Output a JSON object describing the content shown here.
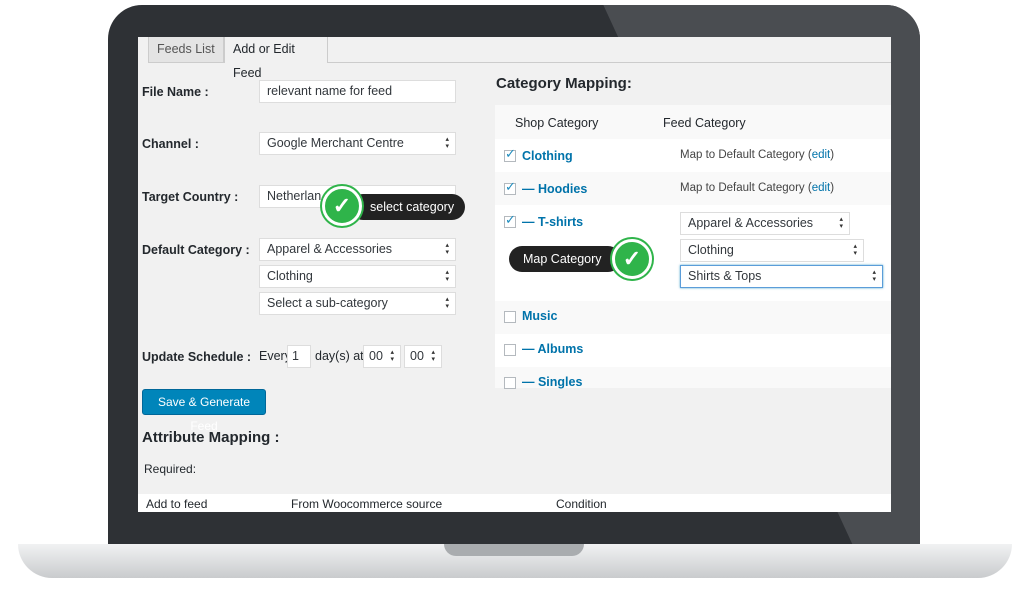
{
  "tabs": [
    "Feeds List",
    "Add or Edit Feed"
  ],
  "form": {
    "file_name_label": "File Name :",
    "file_name_value": "relevant name for feed",
    "channel_label": "Channel :",
    "channel_value": "Google Merchant Centre",
    "country_label": "Target Country :",
    "country_value": "Netherlan",
    "default_category_label": "Default Category :",
    "default_category_values": [
      "Apparel & Accessories",
      "Clothing",
      "Select a sub-category"
    ],
    "schedule_label": "Update Schedule :",
    "schedule_every": "Every",
    "schedule_count": "1",
    "schedule_days_at": "day(s) at",
    "schedule_hour": "00",
    "schedule_minute": "00",
    "save_button": "Save & Generate Feed"
  },
  "attribute_mapping": {
    "title": "Attribute Mapping :",
    "required": "Required:",
    "columns": [
      "Add to feed",
      "From Woocommerce source",
      "Condition"
    ]
  },
  "category_mapping": {
    "title": "Category Mapping:",
    "headers": [
      "Shop Category",
      "Feed Category"
    ],
    "rows": [
      {
        "name": "Clothing",
        "checked": true,
        "map_text": "Map to Default Category",
        "edit": "edit"
      },
      {
        "name": "— Hoodies",
        "checked": true,
        "map_text": "Map to Default Category",
        "edit": "edit"
      },
      {
        "name": "— T-shirts",
        "checked": true
      },
      {
        "name": "Music",
        "checked": false
      },
      {
        "name": "— Albums",
        "checked": false
      },
      {
        "name": "— Singles",
        "checked": false
      }
    ],
    "tshirt_selects": [
      "Apparel & Accessories",
      "Clothing",
      "Shirts & Tops"
    ]
  },
  "callouts": {
    "select_category": "select category",
    "map_category": "Map Category"
  },
  "icons": {
    "check": "check-icon",
    "select_arrows": "select-arrows-icon"
  },
  "colors": {
    "accent": "#0073aa",
    "button": "#0085ba",
    "callout_green": "#2fb44a",
    "callout_dark": "#222222"
  }
}
